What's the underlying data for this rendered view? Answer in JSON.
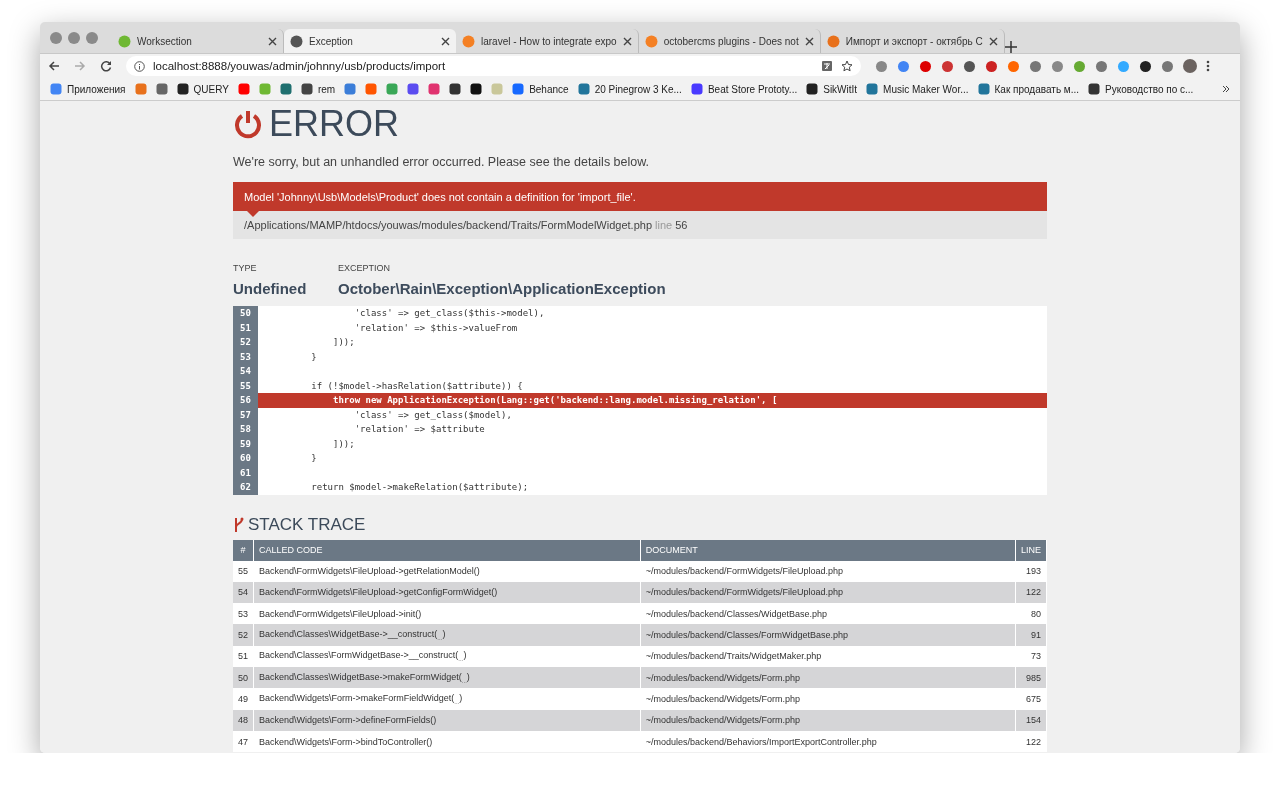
{
  "tabs": [
    {
      "title": "Worksection",
      "selected": false,
      "color": "#6fb833"
    },
    {
      "title": "Exception",
      "selected": true,
      "color": "#555555"
    },
    {
      "title": "laravel - How to integrate expo",
      "selected": false,
      "color": "#f48024"
    },
    {
      "title": "octobercms plugins - Does not",
      "selected": false,
      "color": "#f48024"
    },
    {
      "title": "Импорт и экспорт - октябрь С",
      "selected": false,
      "color": "#e8711c"
    }
  ],
  "address": {
    "url": "localhost:8888/youwas/admin/johnny/usb/products/import"
  },
  "bookmarks": [
    {
      "label": "Приложения",
      "color": "#4285f4"
    },
    {
      "color": "#e8711c"
    },
    {
      "color": "#666666"
    },
    {
      "label": "QUERY",
      "color": "#222222"
    },
    {
      "color": "#ff0000"
    },
    {
      "color": "#6fb833"
    },
    {
      "color": "#1f6f6f"
    },
    {
      "label": "rem",
      "color": "#444444"
    },
    {
      "color": "#3b7dd8"
    },
    {
      "color": "#ff5500"
    },
    {
      "color": "#3aa757"
    },
    {
      "color": "#5b4cf0"
    },
    {
      "color": "#e0336f"
    },
    {
      "color": "#333333"
    },
    {
      "color": "#111111"
    },
    {
      "color": "#c9c79a"
    },
    {
      "label": "Behance",
      "color": "#1769ff"
    },
    {
      "label": "20 Pinegrow 3 Ke...",
      "color": "#21759b"
    },
    {
      "label": "Beat Store Prototy...",
      "color": "#4a3aff"
    },
    {
      "label": "SikWitIt",
      "color": "#222222"
    },
    {
      "label": "Music Maker Wor...",
      "color": "#21759b"
    },
    {
      "label": "Как продавать м...",
      "color": "#21759b"
    },
    {
      "label": "Руководство по с...",
      "color": "#333333"
    }
  ],
  "error": {
    "title": "ERROR",
    "subtitle": "We're sorry, but an unhandled error occurred. Please see the details below.",
    "message": "Model 'Johnny\\Usb\\Models\\Product' does not contain a definition for 'import_file'.",
    "file": "/Applications/MAMP/htdocs/youwas/modules/backend/Traits/FormModelWidget.php",
    "line_label": "line",
    "line": "56"
  },
  "details": [
    {
      "label": "TYPE",
      "value": "Undefined"
    },
    {
      "label": "EXCEPTION",
      "value": "October\\Rain\\Exception\\ApplicationException"
    }
  ],
  "code": [
    {
      "number": "50",
      "text": "                'class' => get_class($this->model),",
      "highlighted": false
    },
    {
      "number": "51",
      "text": "                'relation' => $this->valueFrom",
      "highlighted": false
    },
    {
      "number": "52",
      "text": "            ]));",
      "highlighted": false
    },
    {
      "number": "53",
      "text": "        }",
      "highlighted": false
    },
    {
      "number": "54",
      "highlighted": false
    },
    {
      "number": "55",
      "text": "        if (!$model->hasRelation($attribute)) {",
      "highlighted": false
    },
    {
      "number": "56",
      "text": "            throw new ApplicationException(Lang::get('backend::lang.model.missing_relation', [",
      "highlighted": true
    },
    {
      "number": "57",
      "text": "                'class' => get_class($model),",
      "highlighted": false
    },
    {
      "number": "58",
      "text": "                'relation' => $attribute",
      "highlighted": false
    },
    {
      "number": "59",
      "text": "            ]));",
      "highlighted": false
    },
    {
      "number": "60",
      "text": "        }",
      "highlighted": false
    },
    {
      "number": "61",
      "highlighted": false
    },
    {
      "number": "62",
      "text": "        return $model->makeRelation($attribute);",
      "highlighted": false
    }
  ],
  "stack_trace": {
    "title": "STACK TRACE",
    "columns": [
      "#",
      "CALLED CODE",
      "DOCUMENT",
      "LINE"
    ],
    "rows": [
      [
        "55",
        "Backend\\FormWidgets\\FileUpload->getRelationModel()",
        "~/modules/backend/FormWidgets/FileUpload.php",
        "193"
      ],
      [
        "54",
        "Backend\\FormWidgets\\FileUpload->getConfigFormWidget()",
        "~/modules/backend/FormWidgets/FileUpload.php",
        "122"
      ],
      [
        "53",
        "Backend\\FormWidgets\\FileUpload->init()",
        "~/modules/backend/Classes/WidgetBase.php",
        "80"
      ],
      [
        "52",
        "Backend\\Classes\\WidgetBase->__construct($_{...}$)",
        "~/modules/backend/Classes/FormWidgetBase.php",
        "91"
      ],
      [
        "51",
        "Backend\\Classes\\FormWidgetBase->__construct($_{...}$)",
        "~/modules/backend/Traits/WidgetMaker.php",
        "73"
      ],
      [
        "50",
        "Backend\\Classes\\WidgetBase->makeFormWidget($_{...}$)",
        "~/modules/backend/Widgets/Form.php",
        "985"
      ],
      [
        "49",
        "Backend\\Widgets\\Form->makeFormFieldWidget($_{...}$)",
        "~/modules/backend/Widgets/Form.php",
        "675"
      ],
      [
        "48",
        "Backend\\Widgets\\Form->defineFormFields()",
        "~/modules/backend/Widgets/Form.php",
        "154"
      ],
      [
        "47",
        "Backend\\Widgets\\Form->bindToController()",
        "~/modules/backend/Behaviors/ImportExportController.php",
        "122"
      ]
    ]
  }
}
